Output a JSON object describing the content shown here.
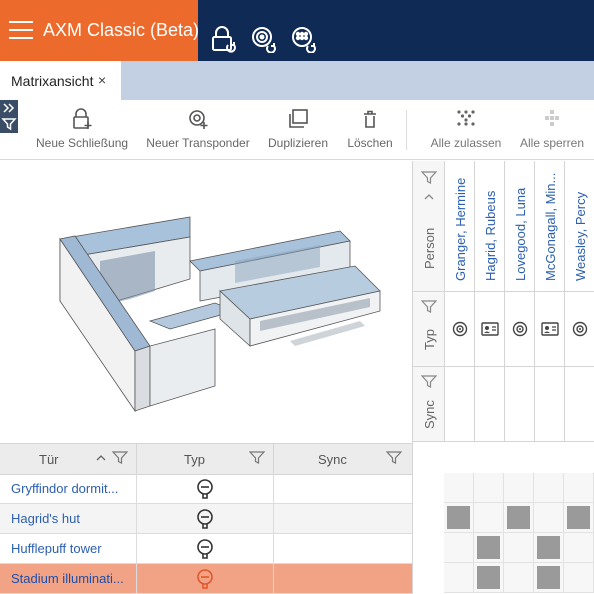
{
  "app": {
    "title": "AXM Classic (Beta)"
  },
  "header_icons": [
    "lock-sync-icon",
    "transponder-sync-icon",
    "network-sync-icon"
  ],
  "tabs": [
    {
      "label": "Matrixansicht",
      "close": "×"
    }
  ],
  "toolbar": {
    "new_lock": "Neue Schließung",
    "new_transponder": "Neuer Transponder",
    "duplicate": "Duplizieren",
    "delete": "Löschen",
    "allow_all": "Alle zulassen",
    "block_all": "Alle sperren"
  },
  "matrix": {
    "filter_labels": {
      "person": "Person",
      "typ": "Typ",
      "sync": "Sync"
    },
    "persons": [
      {
        "name": "Granger, Hermine",
        "type": "transponder-icon"
      },
      {
        "name": "Hagrid, Rubeus",
        "type": "card-icon"
      },
      {
        "name": "Lovegood, Luna",
        "type": "transponder-icon"
      },
      {
        "name": "McGonagall, Min...",
        "type": "card-icon"
      },
      {
        "name": "Weasley, Percy",
        "type": "transponder-icon"
      }
    ],
    "permissions": [
      [
        false,
        false,
        false,
        false,
        false
      ],
      [
        true,
        false,
        true,
        false,
        true
      ],
      [
        false,
        true,
        false,
        true,
        false
      ],
      [
        false,
        true,
        false,
        true,
        false
      ]
    ]
  },
  "door_table": {
    "columns": [
      "Tür",
      "Typ",
      "Sync"
    ],
    "rows": [
      {
        "name": "Gryffindor dormit...",
        "selected": false
      },
      {
        "name": "Hagrid's hut",
        "selected": false
      },
      {
        "name": "Hufflepuff tower",
        "selected": false
      },
      {
        "name": "Stadium illuminati...",
        "selected": true
      }
    ]
  },
  "colors": {
    "header": "#0f2a54",
    "brand": "#ec6a2b",
    "selection": "#f2a386",
    "link": "#2c5fb0"
  }
}
